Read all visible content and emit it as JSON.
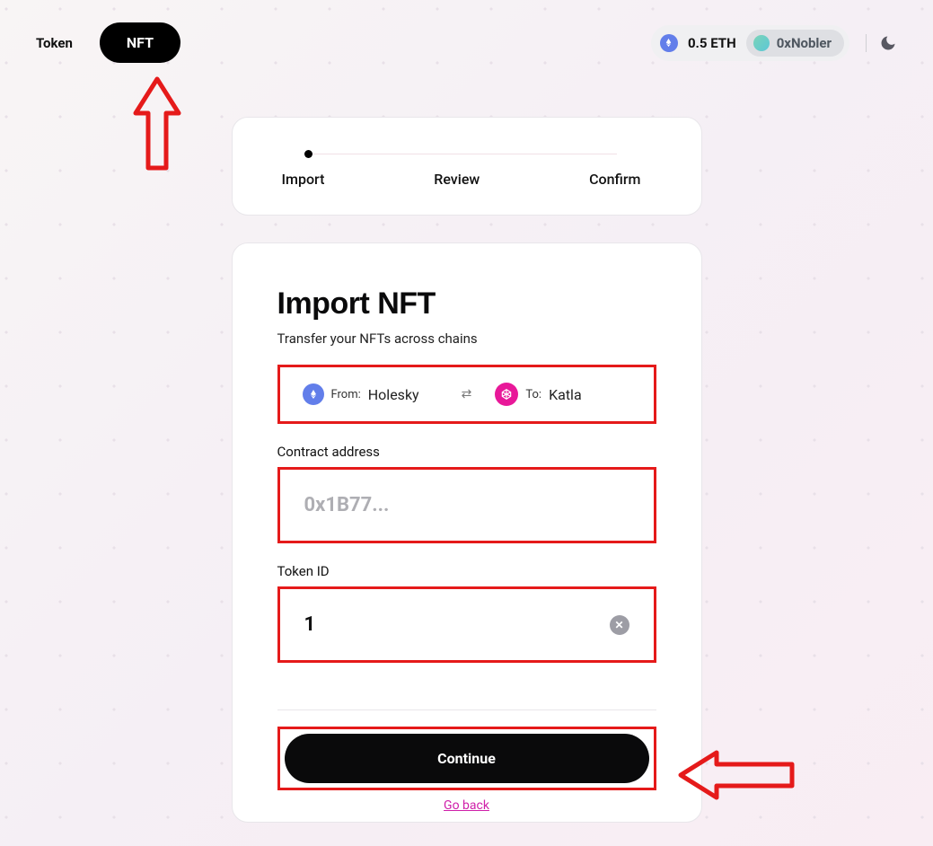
{
  "tabs": {
    "token": "Token",
    "nft": "NFT"
  },
  "wallet": {
    "balance": "0.5 ETH",
    "address": "0xNobler"
  },
  "stepper": {
    "step1": "Import",
    "step2": "Review",
    "step3": "Confirm"
  },
  "card": {
    "title": "Import NFT",
    "subtitle": "Transfer your NFTs across chains",
    "from_label": "From:",
    "from_chain": "Holesky",
    "to_label": "To:",
    "to_chain": "Katla",
    "contract_label": "Contract address",
    "contract_placeholder": "0x1B77...",
    "token_id_label": "Token ID",
    "token_id_value": "1",
    "continue": "Continue",
    "go_back": "Go back"
  }
}
